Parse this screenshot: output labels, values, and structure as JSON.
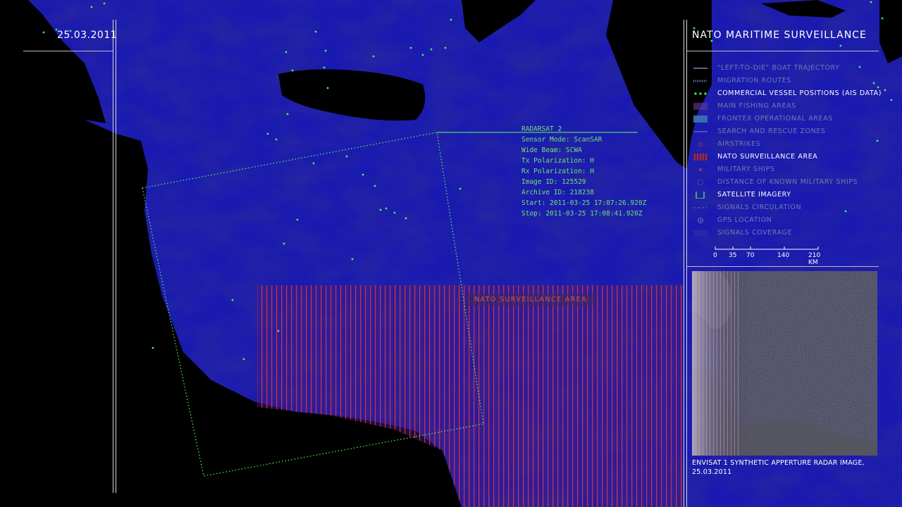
{
  "date": "25.03.2011",
  "title": "NATO MARITIME SURVEILLANCE",
  "legend": [
    {
      "label": "\"LEFT-TO-DIE\" BOAT TRAJECTORY",
      "icon": "line-icon",
      "active": false
    },
    {
      "label": "MIGRATION ROUTES",
      "icon": "dashed-line-icon",
      "active": false
    },
    {
      "label": "COMMERCIAL VESSEL POSITIONS (AIS DATA)",
      "icon": "vessel-dots-icon",
      "active": true
    },
    {
      "label": "MAIN FISHING AREAS",
      "icon": "fishing-area-icon",
      "active": false
    },
    {
      "label": "FRONTEX OPERATIONAL AREAS",
      "icon": "frontex-area-icon",
      "active": false
    },
    {
      "label": "SEARCH AND RESCUE ZONES",
      "icon": "rescue-line-icon",
      "active": false
    },
    {
      "label": "AIRSTRIKES",
      "icon": "airstrike-icon",
      "active": false
    },
    {
      "label": "NATO SURVEILLANCE AREA",
      "icon": "nato-hatch-icon",
      "active": true
    },
    {
      "label": "MILITARY SHIPS",
      "icon": "military-ship-icon",
      "active": false
    },
    {
      "label": "DISTANCE OF KNOWN MILITARY SHIPS",
      "icon": "distance-icon",
      "active": false
    },
    {
      "label": "SATELLITE IMAGERY",
      "icon": "satellite-square-icon",
      "active": true
    },
    {
      "label": "SIGNALS CIRCULATION",
      "icon": "signal-dash-icon",
      "active": false
    },
    {
      "label": "GPS LOCATION",
      "icon": "gps-circle-icon",
      "active": false
    },
    {
      "label": "SIGNALS COVERAGE",
      "icon": "coverage-lines-icon",
      "active": false
    }
  ],
  "scale": {
    "ticks": [
      "0",
      "35",
      "70",
      "140",
      "210 KM"
    ]
  },
  "radarsat": {
    "name": "RADARSAT_2",
    "lines": [
      "Sensor Mode: ScanSAR",
      "Wide Beam: SCWA",
      "Tx Polarization: H",
      "Rx Polarization: H",
      "Image ID: 125529",
      "Archive ID: 218238",
      "Start: 2011-03-25 17:07:26.920Z",
      "Stop: 2011-03-25 17:08:41.920Z"
    ]
  },
  "nato_label": "NATO SURVEILLANCE AREA",
  "caption": {
    "line1": "ENVISAT 1 SYNTHETIC APPERTURE RADAR IMAGE,",
    "line2": "25.03.2011"
  },
  "colors": {
    "sea": "#1c1cb4",
    "land": "#000000",
    "vessel": "#3dff4a",
    "nato": "#c0283c",
    "radar_text": "#6ee36e"
  }
}
